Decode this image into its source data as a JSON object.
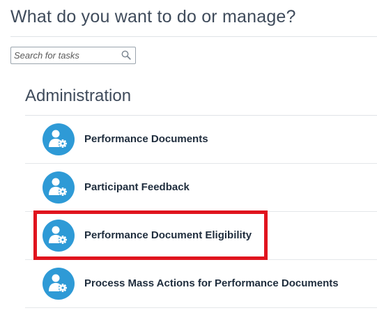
{
  "header": {
    "title": "What do you want to do or manage?"
  },
  "search": {
    "placeholder": "Search for tasks",
    "value": "",
    "icon": "magnifier-icon"
  },
  "section": {
    "title": "Administration",
    "items": [
      {
        "label": "Performance Documents",
        "icon": "user-gear-icon",
        "highlighted": false
      },
      {
        "label": "Participant Feedback",
        "icon": "user-gear-icon",
        "highlighted": false
      },
      {
        "label": "Performance Document Eligibility",
        "icon": "user-gear-icon",
        "highlighted": true
      },
      {
        "label": "Process Mass Actions for Performance Documents",
        "icon": "user-gear-icon",
        "highlighted": false
      }
    ]
  },
  "colors": {
    "icon_blue": "#2e9ad6",
    "highlight_red": "#e0141e",
    "heading": "#3f4b5b",
    "label": "#1f2d3d"
  }
}
